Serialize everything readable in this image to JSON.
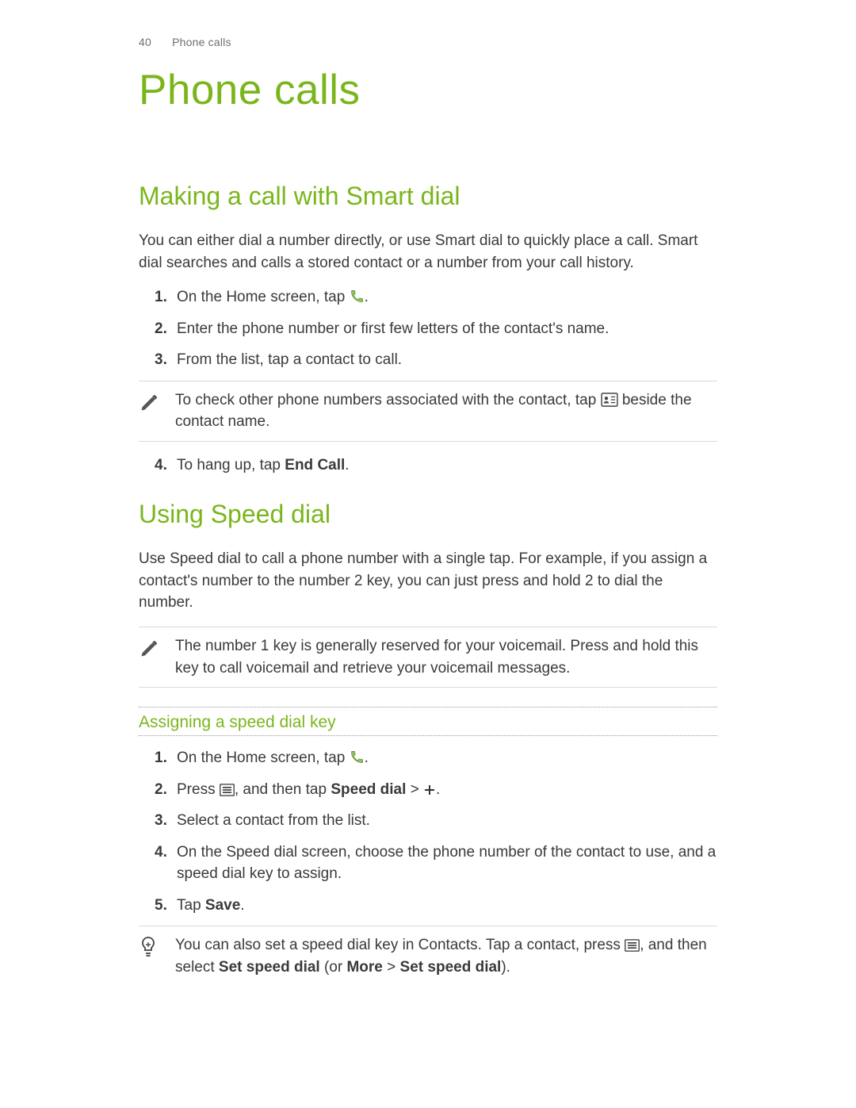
{
  "header": {
    "page_number": "40",
    "running_title": "Phone calls"
  },
  "chapter_title": "Phone calls",
  "section1": {
    "title": "Making a call with Smart dial",
    "intro": "You can either dial a number directly, or use Smart dial to quickly place a call. Smart dial searches and calls a stored contact or a number from your call history.",
    "step1_a": "On the Home screen, tap ",
    "step1_b": ".",
    "step2": "Enter the phone number or first few letters of the contact's name.",
    "step3": "From the list, tap a contact to call.",
    "note_a": "To check other phone numbers associated with the contact, tap ",
    "note_b": " beside the contact name.",
    "step4_a": "To hang up, tap ",
    "step4_bold": "End Call",
    "step4_b": "."
  },
  "section2": {
    "title": "Using Speed dial",
    "intro": "Use Speed dial to call a phone number with a single tap. For example, if you assign a contact's number to the number 2 key, you can just press and hold 2 to dial the number.",
    "note": "The number 1 key is generally reserved for your voicemail. Press and hold this key to call voicemail and retrieve your voicemail messages.",
    "subsection_title": "Assigning a speed dial key",
    "s1_a": "On the Home screen, tap ",
    "s1_b": ".",
    "s2_a": "Press ",
    "s2_b": ", and then tap ",
    "s2_bold": "Speed dial",
    "s2_c": " > ",
    "s2_d": ".",
    "s3": "Select a contact from the list.",
    "s4": "On the Speed dial screen, choose the phone number of the contact to use, and a speed dial key to assign.",
    "s5_a": "Tap ",
    "s5_bold": "Save",
    "s5_b": ".",
    "tip_a": "You can also set a speed dial key in Contacts. Tap a contact, press ",
    "tip_b": ", and then select ",
    "tip_bold1": "Set speed dial",
    "tip_c": " (or ",
    "tip_bold2": "More",
    "tip_d": " > ",
    "tip_bold3": "Set speed dial",
    "tip_e": ")."
  }
}
